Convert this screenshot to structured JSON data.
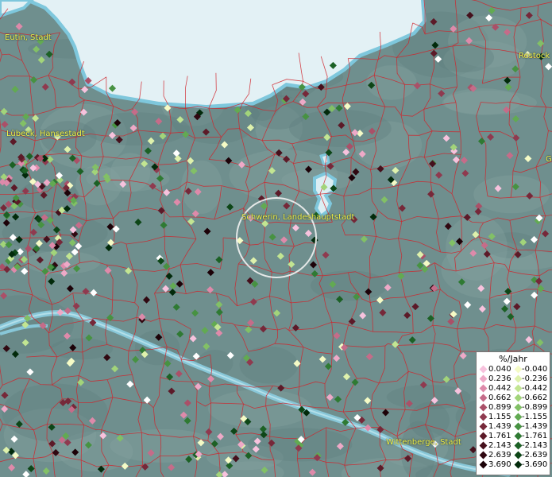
{
  "map": {
    "cities": [
      {
        "name": "Eutin, Stadt"
      },
      {
        "name": "Rostock"
      },
      {
        "name": "Lübeck, Hansestadt"
      },
      {
        "name": "Schwerin, Landeshauptstadt"
      },
      {
        "name": "Wittenberge, Stadt"
      },
      {
        "name": "G"
      }
    ],
    "colors": {
      "land": "#6f8f8e",
      "sea": "#e3f1f5",
      "water_edge": "#7ec7dc",
      "borders": "#d0252b",
      "city_label": "#f2f24a"
    }
  },
  "legend": {
    "title": "%/Jahr",
    "positive": [
      {
        "value": "0.040",
        "color": "#f7c2dd"
      },
      {
        "value": "0.236",
        "color": "#eea9c7"
      },
      {
        "value": "0.442",
        "color": "#de8aaa"
      },
      {
        "value": "0.662",
        "color": "#c56c89"
      },
      {
        "value": "0.899",
        "color": "#aa5068"
      },
      {
        "value": "1.155",
        "color": "#8f3a4f"
      },
      {
        "value": "1.439",
        "color": "#762839"
      },
      {
        "value": "1.761",
        "color": "#5c1a28"
      },
      {
        "value": "2.143",
        "color": "#45101c"
      },
      {
        "value": "2.639",
        "color": "#300811"
      },
      {
        "value": "3.690",
        "color": "#1c0208"
      }
    ],
    "negative": [
      {
        "value": "-0.040",
        "color": "#f5fbc6"
      },
      {
        "value": "-0.236",
        "color": "#def1ac"
      },
      {
        "value": "-0.442",
        "color": "#c2e592"
      },
      {
        "value": "-0.662",
        "color": "#a2d47a"
      },
      {
        "value": "-0.899",
        "color": "#82c066"
      },
      {
        "value": "-1.155",
        "color": "#62aa52"
      },
      {
        "value": "-1.439",
        "color": "#479242"
      },
      {
        "value": "-1.761",
        "color": "#2f7a33"
      },
      {
        "value": "-2.143",
        "color": "#1c6125"
      },
      {
        "value": "-2.639",
        "color": "#0d4617"
      },
      {
        "value": "-3.690",
        "color": "#022a0b"
      }
    ]
  }
}
